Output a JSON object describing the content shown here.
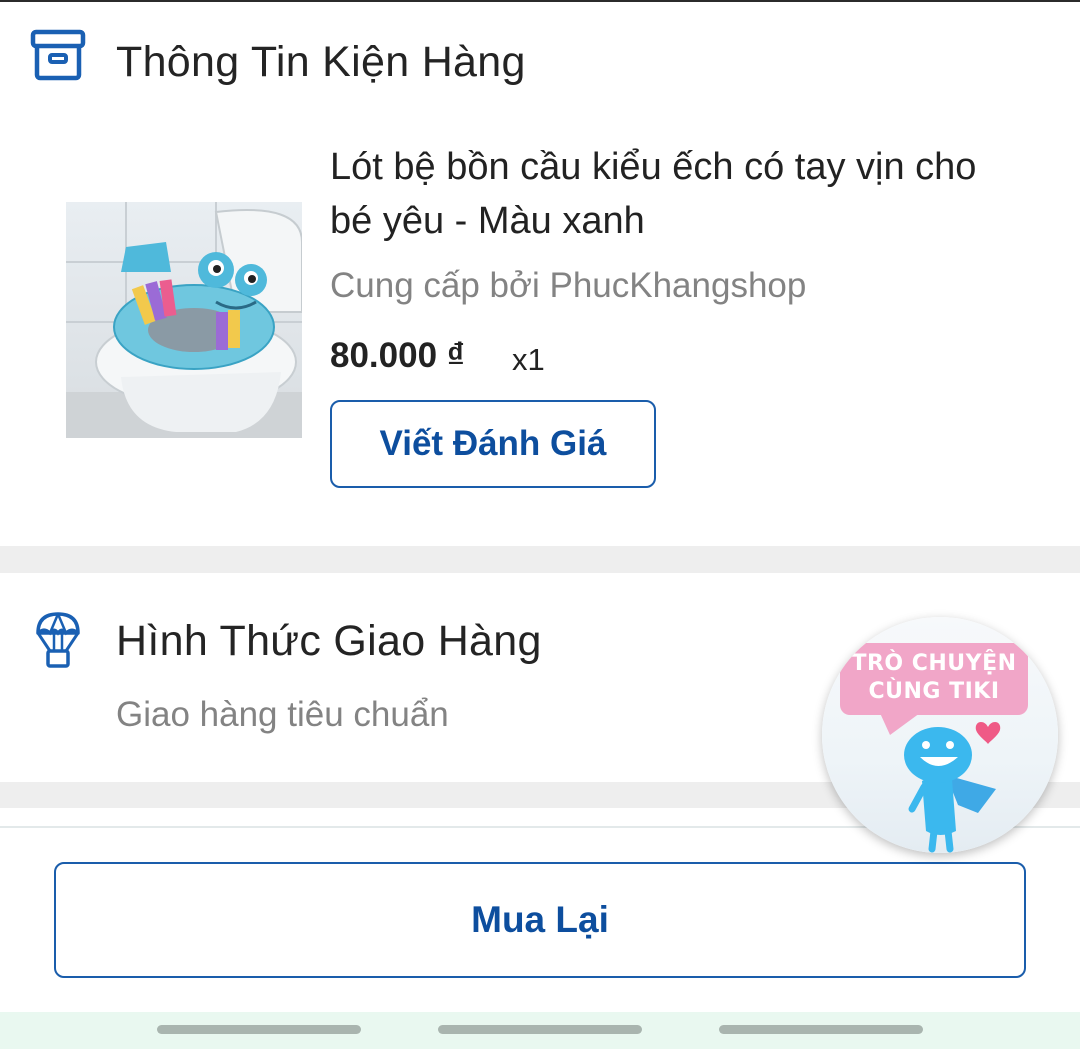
{
  "package_section": {
    "title": "Thông Tin Kiện Hàng",
    "icon": "package-box-icon",
    "product": {
      "name": "Lót bệ bồn cầu kiểu ếch có tay vịn cho bé yêu  - Màu xanh",
      "seller": "Cung cấp bởi PhucKhangshop",
      "price": "80.000 ₫",
      "quantity": "x1",
      "review_button": "Viết Đánh Giá"
    }
  },
  "shipping_section": {
    "title": "Hình Thức Giao Hàng",
    "icon": "parachute-delivery-icon",
    "method": "Giao hàng tiêu chuẩn"
  },
  "bottom_bar": {
    "rebuy_button": "Mua Lại"
  },
  "chat_widget": {
    "line1": "TRÒ CHUYỆN",
    "line2": "CÙNG TIKI"
  },
  "colors": {
    "accent": "#0d4e9e",
    "icon_blue": "#1a60b3",
    "divider": "#eeeeee",
    "muted_text": "#838383",
    "chat_pink": "#f1a6c8",
    "mascot_blue": "#3bb8ee"
  }
}
